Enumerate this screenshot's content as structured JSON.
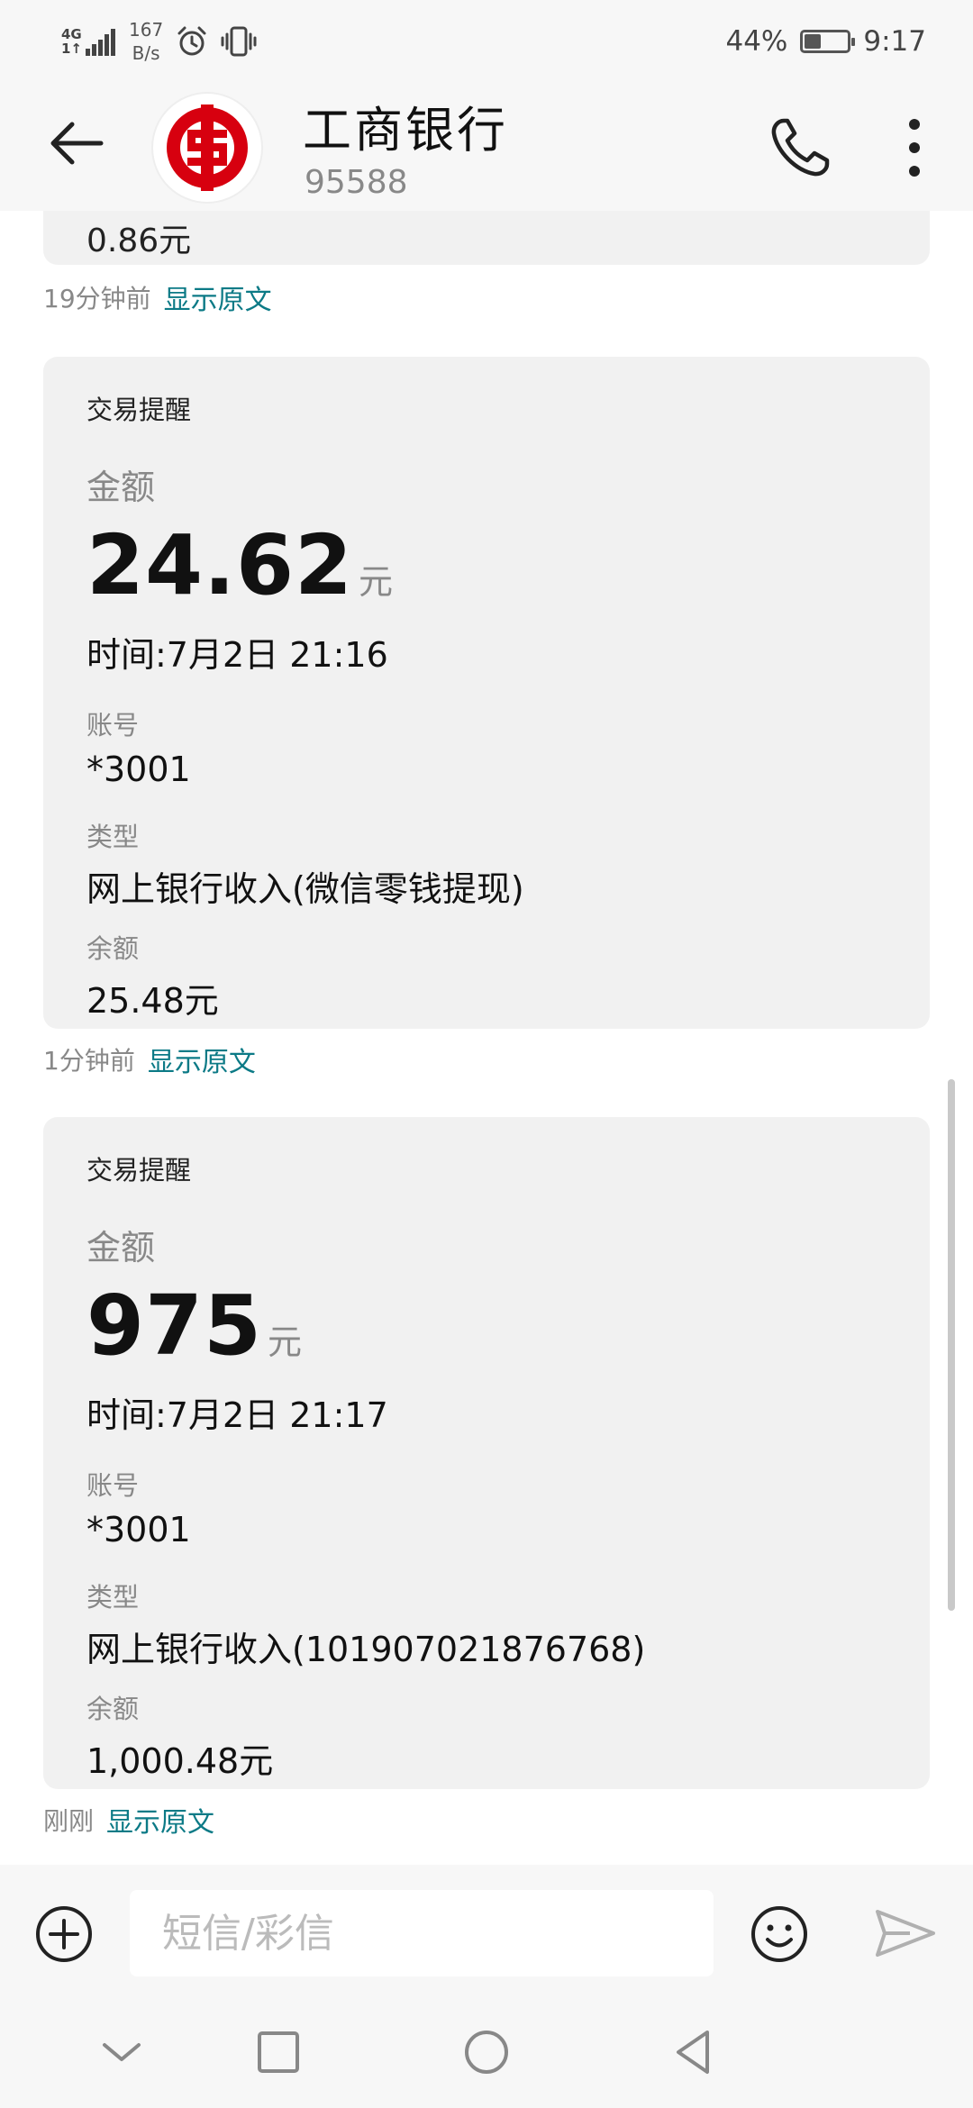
{
  "status_bar": {
    "network": "4G",
    "network_sub": "1↑",
    "speed_value": "167",
    "speed_unit": "B/s",
    "battery": "44%",
    "battery_level": 0.44,
    "time": "9:17"
  },
  "header": {
    "contact_name": "工商银行",
    "contact_number": "95588"
  },
  "messages": {
    "partial": {
      "amount_text": "0.86元",
      "time_ago": "19分钟前",
      "show_original": "显示原文"
    },
    "m1": {
      "title": "交易提醒",
      "amount_label": "金额",
      "amount_value": "24.62",
      "amount_unit": "元",
      "time": "时间:7月2日 21:16",
      "account_label": "账号",
      "account": "*3001",
      "type_label": "类型",
      "type": "网上银行收入(微信零钱提现)",
      "balance_label": "余额",
      "balance": "25.48元",
      "time_ago": "1分钟前",
      "show_original": "显示原文"
    },
    "m2": {
      "title": "交易提醒",
      "amount_label": "金额",
      "amount_value": "975",
      "amount_unit": "元",
      "time": "时间:7月2日 21:17",
      "account_label": "账号",
      "account": "*3001",
      "type_label": "类型",
      "type": "网上银行收入(101907021876768)",
      "balance_label": "余额",
      "balance": "1,000.48元",
      "time_ago": "刚刚",
      "show_original": "显示原文"
    }
  },
  "composer": {
    "placeholder": "短信/彩信"
  },
  "colors": {
    "accent": "#0c7a86",
    "brand_red": "#d7000f"
  }
}
